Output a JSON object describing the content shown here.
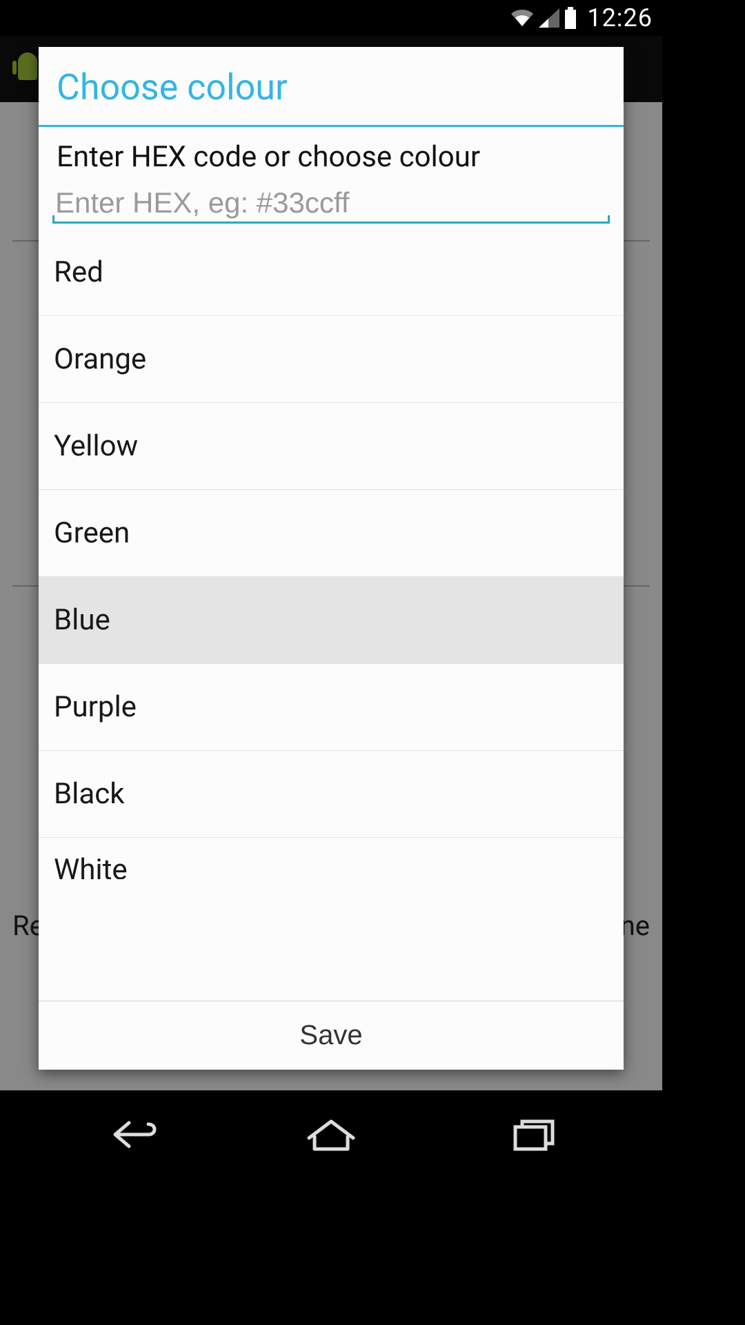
{
  "status": {
    "time": "12:26"
  },
  "dialog": {
    "title": "Choose colour",
    "instruction": "Enter HEX code or choose colour",
    "hex_placeholder": "Enter HEX, eg: #33ccff",
    "hex_value": "",
    "save_label": "Save",
    "colors": [
      {
        "label": "Red",
        "selected": false
      },
      {
        "label": "Orange",
        "selected": false
      },
      {
        "label": "Yellow",
        "selected": false
      },
      {
        "label": "Green",
        "selected": false
      },
      {
        "label": "Blue",
        "selected": true
      },
      {
        "label": "Purple",
        "selected": false
      },
      {
        "label": "Black",
        "selected": false
      },
      {
        "label": "White",
        "selected": false
      }
    ]
  },
  "background_hints": {
    "left_fragment": "Re",
    "right_fragment": "ne"
  },
  "accent_color": "#33b5e5"
}
